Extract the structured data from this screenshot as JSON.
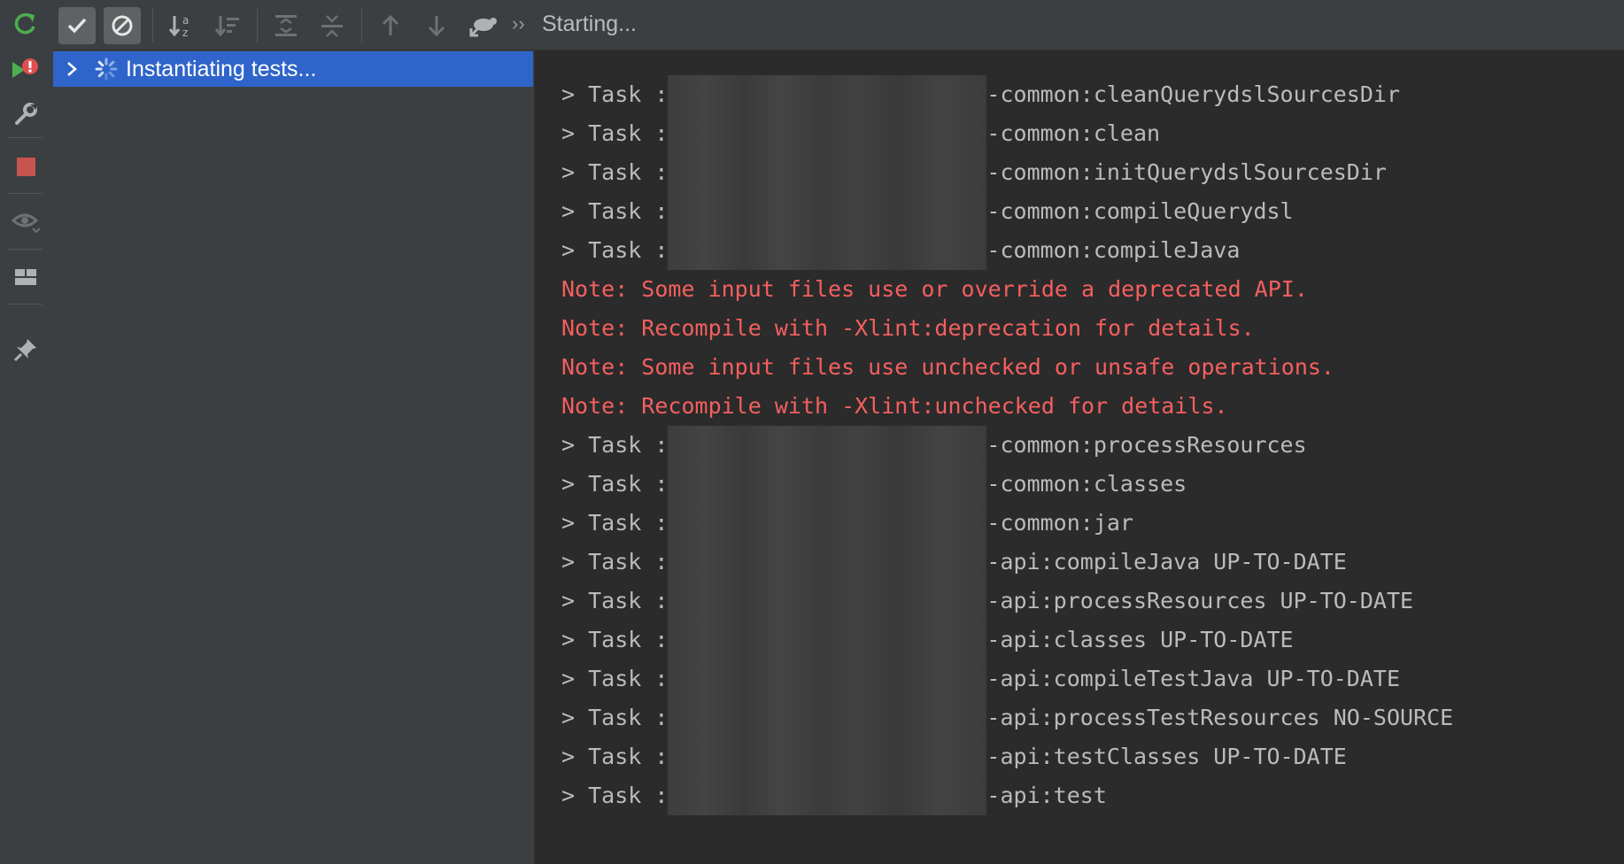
{
  "toolbar": {
    "status": "Starting...",
    "icons": [
      "check-icon",
      "cancel-circle-icon",
      "sort-alpha-icon",
      "sort-duration-icon",
      "expand-all-icon",
      "collapse-all-icon",
      "arrow-up-icon",
      "arrow-down-icon",
      "import-tests-icon",
      "chevron-right-double-icon"
    ]
  },
  "sidebar": {
    "icons": [
      "rerun-icon",
      "rerun-failed-icon",
      "settings-wrench-icon",
      "stop-icon",
      "eye-icon",
      "layout-icon",
      "pin-icon"
    ]
  },
  "tree": {
    "item": "Instantiating tests..."
  },
  "console": {
    "lines": [
      {
        "prefix": "> Task :",
        "text": "-common:cleanQuerydslSourcesDir"
      },
      {
        "prefix": "> Task :",
        "text": "-common:clean"
      },
      {
        "prefix": "> Task :",
        "text": "-common:initQuerydslSourcesDir"
      },
      {
        "prefix": "> Task :",
        "text": "-common:compileQuerydsl"
      },
      {
        "prefix": "> Task :",
        "text": "-common:compileJava"
      },
      {
        "prefix": "",
        "text": "Note: Some input files use or override a deprecated API."
      },
      {
        "prefix": "",
        "text": "Note: Recompile with -Xlint:deprecation for details."
      },
      {
        "prefix": "",
        "text": "Note: Some input files use unchecked or unsafe operations."
      },
      {
        "prefix": "",
        "text": "Note: Recompile with -Xlint:unchecked for details."
      },
      {
        "prefix": "> Task :",
        "text": "-common:processResources"
      },
      {
        "prefix": "> Task :",
        "text": "-common:classes"
      },
      {
        "prefix": "> Task :",
        "text": "-common:jar"
      },
      {
        "prefix": "> Task :",
        "text": "-api:compileJava UP-TO-DATE"
      },
      {
        "prefix": "> Task :",
        "text": "-api:processResources UP-TO-DATE"
      },
      {
        "prefix": "> Task :",
        "text": "-api:classes UP-TO-DATE"
      },
      {
        "prefix": "> Task :",
        "text": "-api:compileTestJava UP-TO-DATE"
      },
      {
        "prefix": "> Task :",
        "text": "-api:processTestResources NO-SOURCE"
      },
      {
        "prefix": "> Task :",
        "text": "-api:testClasses UP-TO-DATE"
      },
      {
        "prefix": "> Task :",
        "text": "-api:test"
      }
    ]
  },
  "colors": {
    "selection": "#2f65ca",
    "note": "#f55f5f",
    "rerun": "#4caf50",
    "stop": "#c75450",
    "badge": "#e04f4f"
  }
}
